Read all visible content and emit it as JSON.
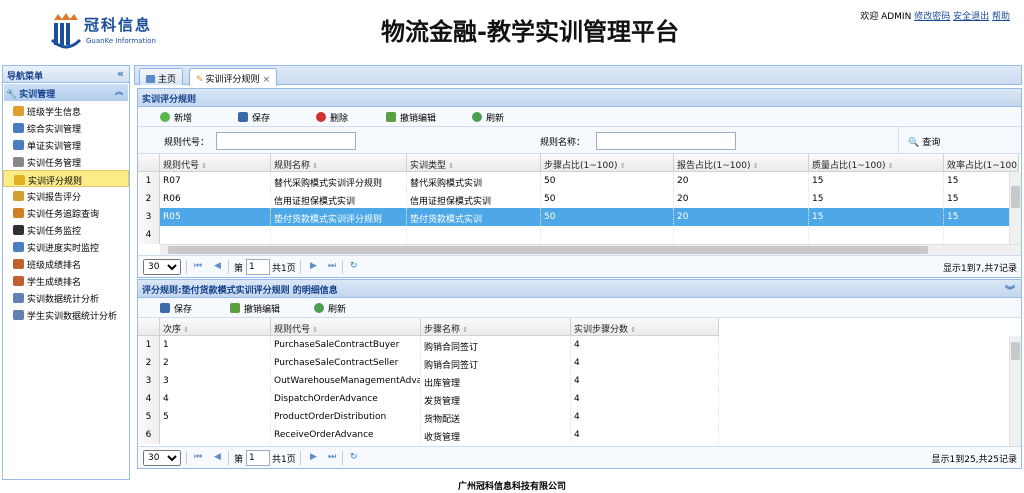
{
  "header": {
    "logo_cn": "冠科信息",
    "logo_en": "GuanKe Information",
    "title": "物流金融-教学实训管理平台",
    "welcome": "欢迎 ADMIN",
    "change_password": "修改密码",
    "logout": "安全退出",
    "help": "帮助"
  },
  "sidebar": {
    "title": "导航菜单",
    "group": "实训管理",
    "items": [
      {
        "label": "班级学生信息",
        "icon_color": "#e0a030"
      },
      {
        "label": "综合实训管理",
        "icon_color": "#4a7dc0"
      },
      {
        "label": "单证实训管理",
        "icon_color": "#4a7dc0"
      },
      {
        "label": "实训任务管理",
        "icon_color": "#888888"
      },
      {
        "label": "实训评分规则",
        "icon_color": "#e0b020",
        "selected": true
      },
      {
        "label": "实训报告评分",
        "icon_color": "#d0a030"
      },
      {
        "label": "实训任务追踪查询",
        "icon_color": "#d08020"
      },
      {
        "label": "实训任务监控",
        "icon_color": "#303030"
      },
      {
        "label": "实训进度实时监控",
        "icon_color": "#4a80c0"
      },
      {
        "label": "班级成绩排名",
        "icon_color": "#c06030"
      },
      {
        "label": "学生成绩排名",
        "icon_color": "#c06030"
      },
      {
        "label": "实训数据统计分析",
        "icon_color": "#6080b0"
      },
      {
        "label": "学生实训数据统计分析",
        "icon_color": "#6080b0"
      }
    ]
  },
  "tabs": [
    {
      "label": "主页"
    },
    {
      "label": "实训评分规则",
      "close": "×"
    }
  ],
  "panel1": {
    "title": "实训评分规则",
    "toolbar": {
      "add": "新增",
      "save": "保存",
      "delete": "删除",
      "undo": "撤销编辑",
      "refresh": "刷新"
    },
    "search": {
      "rule_code_label": "规则代号：",
      "rule_name_label": "规则名称：",
      "query": "查询"
    },
    "columns": [
      "规则代号",
      "规则名称",
      "实训类型",
      "步骤占比(1~100)",
      "报告占比(1~100)",
      "质量占比(1~100)",
      "效率占比(1~100)"
    ],
    "rows": [
      {
        "n": "1",
        "cells": [
          "R07",
          "替代采购模式实训评分规则",
          "替代采购模式实训",
          "50",
          "20",
          "15",
          "15"
        ]
      },
      {
        "n": "2",
        "cells": [
          "R06",
          "信用证担保模式实训",
          "信用证担保模式实训",
          "50",
          "20",
          "15",
          "15"
        ]
      },
      {
        "n": "3",
        "cells": [
          "R05",
          "垫付货款模式实训评分规则",
          "垫付货款模式实训",
          "50",
          "20",
          "15",
          "15"
        ],
        "selected": true
      },
      {
        "n": "4",
        "cells": [
          "",
          "",
          "",
          "",
          "",
          "",
          ""
        ]
      }
    ],
    "pager": {
      "size": "30",
      "page_prefix": "第",
      "page": "1",
      "page_suffix": "共1页",
      "info": "显示1到7,共7记录"
    }
  },
  "panel2": {
    "title": "评分规则:垫付货款模式实训评分规则 的明细信息",
    "toolbar": {
      "save": "保存",
      "undo": "撤销编辑",
      "refresh": "刷新"
    },
    "columns": [
      "次序",
      "规则代号",
      "步骤名称",
      "实训步骤分数"
    ],
    "rows": [
      {
        "n": "1",
        "cells": [
          "1",
          "PurchaseSaleContractBuyer",
          "购销合同签订",
          "4"
        ]
      },
      {
        "n": "2",
        "cells": [
          "2",
          "PurchaseSaleContractSeller",
          "购销合同签订",
          "4"
        ]
      },
      {
        "n": "3",
        "cells": [
          "3",
          "OutWarehouseManagementAdvance",
          "出库管理",
          "4"
        ]
      },
      {
        "n": "4",
        "cells": [
          "4",
          "DispatchOrderAdvance",
          "发货管理",
          "4"
        ]
      },
      {
        "n": "5",
        "cells": [
          "5",
          "ProductOrderDistribution",
          "货物配送",
          "4"
        ]
      },
      {
        "n": "6",
        "cells": [
          "",
          "ReceiveOrderAdvance",
          "收货管理",
          "4"
        ]
      }
    ],
    "pager": {
      "size": "30",
      "page_prefix": "第",
      "page": "1",
      "page_suffix": "共1页",
      "info": "显示1到25,共25记录"
    }
  },
  "footer": "广州冠科信息科技有限公司",
  "colors": {
    "selected_row": "#4ea8e8",
    "panel_border": "#99bbe8",
    "header_text": "#15428b"
  }
}
